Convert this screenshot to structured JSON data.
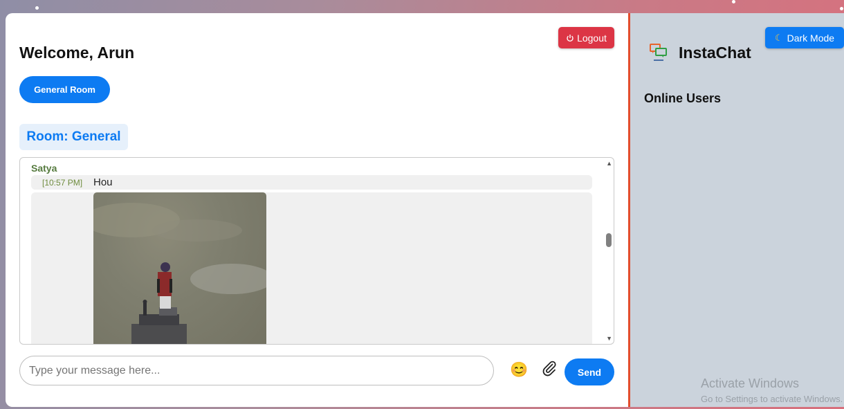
{
  "header": {
    "logout_label": "Logout",
    "welcome": "Welcome, Arun"
  },
  "rooms": {
    "general_label": "General Room"
  },
  "room_header": "Room: General",
  "messages": [
    {
      "sender": "Satya",
      "time": "[10:57 PM]",
      "text": "Hou"
    }
  ],
  "composer": {
    "placeholder": "Type your message here...",
    "emoji": "😊",
    "send_label": "Send"
  },
  "sidebar": {
    "dark_mode_label": "Dark Mode",
    "brand": "InstaChat",
    "online_users_title": "Online Users"
  },
  "watermark": {
    "line1": "Activate Windows",
    "line2": "Go to Settings to activate Windows."
  },
  "colors": {
    "primary": "#0d7bf2",
    "danger": "#dc3545",
    "sidebar_bg": "#cbd3dc",
    "sender": "#557a3e"
  },
  "icons": [
    "power-icon",
    "moon-icon",
    "chat-logo-icon",
    "emoji-icon",
    "paperclip-icon"
  ]
}
